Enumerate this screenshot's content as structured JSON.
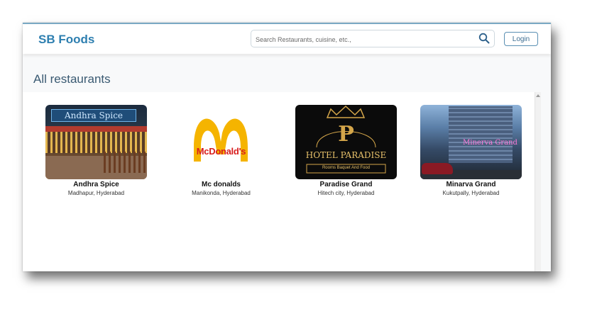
{
  "app": {
    "brand": "SB Foods"
  },
  "search": {
    "placeholder": "Search Restaurants, cuisine, etc.,"
  },
  "auth": {
    "login_label": "Login"
  },
  "page": {
    "title": "All restaurants"
  },
  "restaurants": [
    {
      "name": "Andhra Spice",
      "location": "Madhapur, Hyderabad",
      "sign_text": "Andhra Spice"
    },
    {
      "name": "Mc donalds",
      "location": "Manikonda, Hyderabad",
      "logo_text": "McDonald's"
    },
    {
      "name": "Paradise Grand",
      "location": "Hitech city, Hyderabad",
      "logo_letter": "P",
      "logo_text": "HOTEL PARADISE",
      "tagline": "Rooms Baquet And Food"
    },
    {
      "name": "Minarva Grand",
      "location": "Kukutpally, Hyderabad",
      "sign_text": "Minerva Grand"
    }
  ],
  "colors": {
    "brand": "#2e7fb0",
    "title": "#3a5a72",
    "login_border": "#5a8fb3"
  },
  "icons": {
    "search": "search-icon",
    "scroll_up": "chevron-up-icon"
  }
}
